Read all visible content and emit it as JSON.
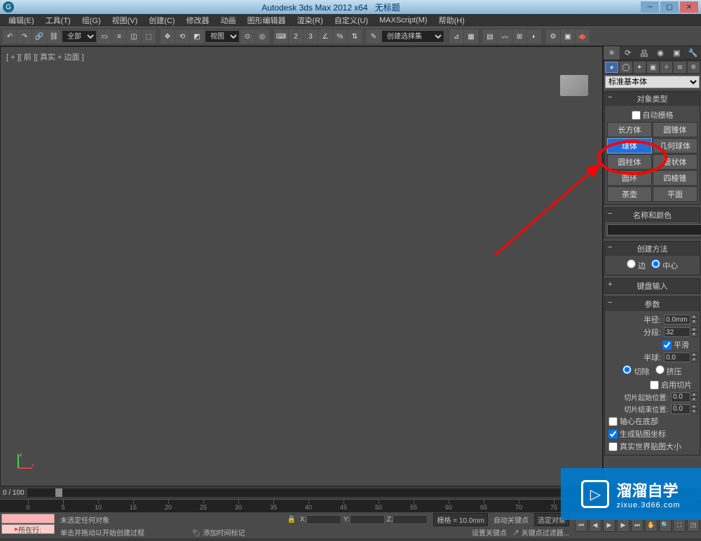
{
  "titlebar": {
    "app_name": "Autodesk 3ds Max 2012 x64",
    "doc_name": "无标题"
  },
  "menu": {
    "edit": "编辑(E)",
    "tools": "工具(T)",
    "group": "组(G)",
    "views": "视图(V)",
    "create": "创建(C)",
    "modifiers": "修改器",
    "animation": "动画",
    "graph": "图形编辑器",
    "rendering": "渲染(R)",
    "customize": "自定义(U)",
    "maxscript": "MAXScript(M)",
    "help": "帮助(H)"
  },
  "toolbar": {
    "selection_filter": "全部",
    "view_label": "视图",
    "named_set": "创建选择集"
  },
  "viewport": {
    "label": "[ + ][ 前 ][ 真实 + 边面 ]"
  },
  "cmdpanel": {
    "category_dropdown": "标准基本体",
    "rollout_objtype": "对象类型",
    "autogrid_label": "自动栅格",
    "primitives": {
      "box": "长方体",
      "cone": "圆锥体",
      "sphere": "球体",
      "geosphere": "几何球体",
      "cylinder": "圆柱体",
      "tube": "管状体",
      "torus": "圆环",
      "pyramid": "四棱锥",
      "teapot": "茶壶",
      "plane": "平面"
    },
    "rollout_name": "名称和颜色",
    "rollout_method": "创建方法",
    "method_edge": "边",
    "method_center": "中心",
    "rollout_keyboard": "键盘输入",
    "rollout_params": "参数",
    "param_radius": "半径:",
    "param_radius_val": "0.0mm",
    "param_segments": "分段:",
    "param_segments_val": "32",
    "param_smooth": "平滑",
    "param_hemisphere": "半球:",
    "param_hemisphere_val": "0.0",
    "param_chop": "切除",
    "param_squash": "挤压",
    "param_sliceon": "启用切片",
    "param_slicefrom": "切片起始位置:",
    "param_slicefrom_val": "0.0",
    "param_sliceto": "切片结束位置:",
    "param_sliceto_val": "0.0",
    "param_basepivot": "轴心在底部",
    "param_mapcoords": "生成贴图坐标",
    "param_realworld": "真实世界贴图大小"
  },
  "trackbar": {
    "range": "0 / 100"
  },
  "status": {
    "prompt1": "未选定任何对象",
    "prompt2": "单击并拖动以开始创建过程",
    "at_row": "所在行:",
    "add_time_tag": "添加时间标记",
    "x_label": "X:",
    "y_label": "Y:",
    "z_label": "Z:",
    "grid": "栅格 = 10.0mm",
    "autokey": "自动关键点",
    "setkey": "设置关键点",
    "selected": "选定对象",
    "keyfilter": "关键点过滤器..."
  },
  "watermark": {
    "main": "溜溜自学",
    "sub": "zixue.3d66.com"
  }
}
